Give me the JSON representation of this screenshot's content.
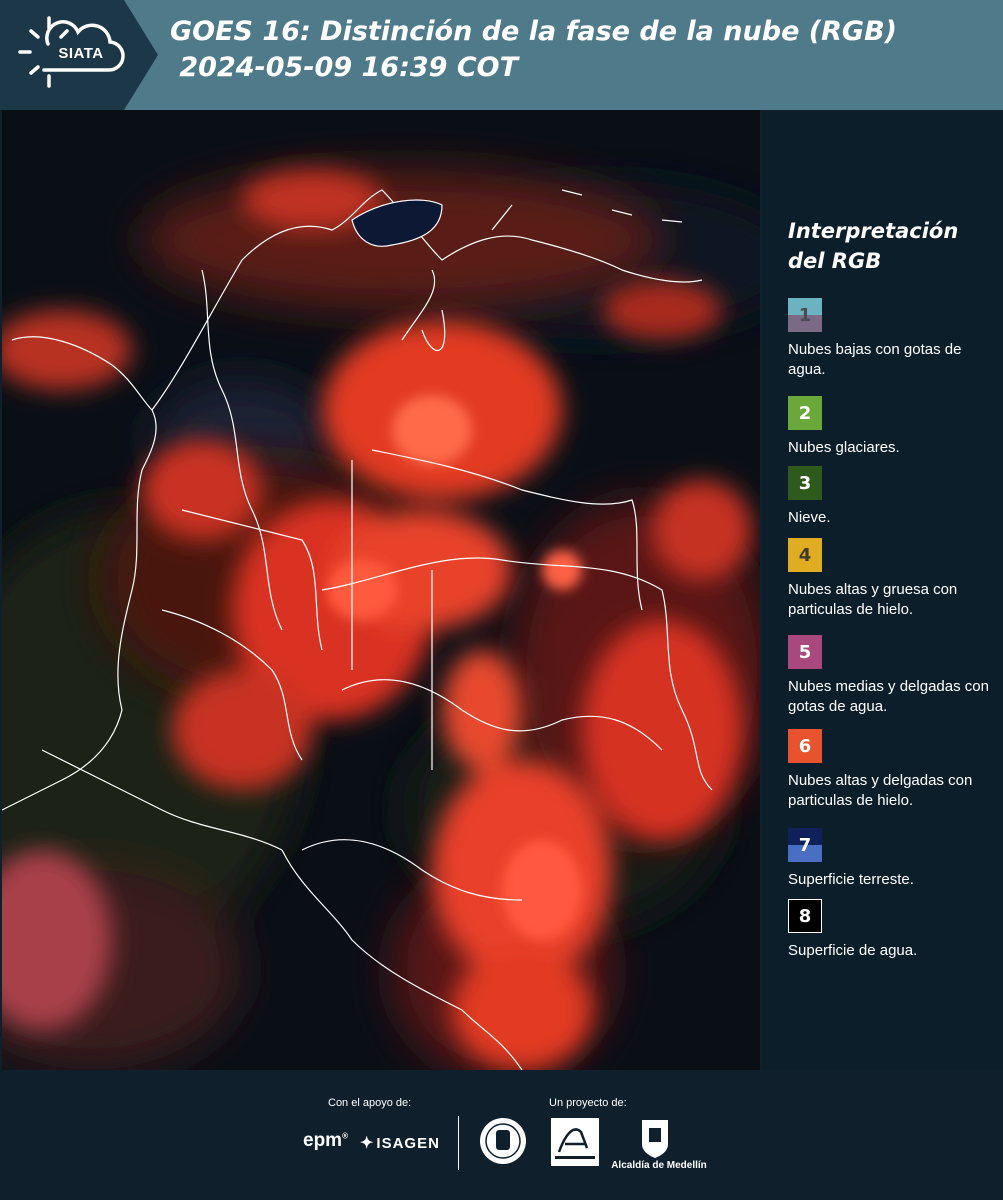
{
  "header": {
    "logo_text": "SIATA",
    "title": "GOES 16: Distinción de la fase de la nube (RGB)\n 2024-05-09 16:39 COT"
  },
  "legend": {
    "title": "Interpretación del RGB",
    "items": [
      {
        "number": "1",
        "description": "Nubes bajas con gotas de agua.",
        "color_top": "#6cb3c1",
        "color_bottom": "#7a6a86",
        "text_color": "#4a4a55"
      },
      {
        "number": "2",
        "description": "Nubes glaciares.",
        "color_top": "#6aa83a",
        "color_bottom": "#6aa83a",
        "text_color": "#ffffff"
      },
      {
        "number": "3",
        "description": "Nieve.",
        "color_top": "#2e5a1c",
        "color_bottom": "#2e5a1c",
        "text_color": "#ffffff"
      },
      {
        "number": "4",
        "description": "Nubes altas y gruesa con particulas de hielo.",
        "color_top": "#e0ad22",
        "color_bottom": "#e0ad22",
        "text_color": "#3f3a2c"
      },
      {
        "number": "5",
        "description": "Nubes medias y delgadas con gotas de agua.",
        "color_top": "#a8487e",
        "color_bottom": "#a8487e",
        "text_color": "#ffffff"
      },
      {
        "number": "6",
        "description": "Nubes altas y delgadas con particulas de hielo.",
        "color_top": "#e8522c",
        "color_bottom": "#e8522c",
        "text_color": "#ffffff"
      },
      {
        "number": "7",
        "description": "Superficie terreste.",
        "color_top": "#10205a",
        "color_bottom": "#4a6ec4",
        "text_color": "#ffffff"
      },
      {
        "number": "8",
        "description": "Superficie de agua.",
        "color_top": "#000000",
        "color_bottom": "#000000",
        "text_color": "#ffffff",
        "border": "#ffffff"
      }
    ]
  },
  "footer": {
    "support_label": "Con el apoyo de:",
    "project_label": "Un proyecto de:",
    "sponsors": [
      "epm",
      "ISAGEN"
    ],
    "alcaldia_text": "Alcaldía de Medellín"
  },
  "colors": {
    "header_bg": "#4f7a8a",
    "panel_bg": "#0d1e2b",
    "cloud_red": "#e23a22",
    "cloud_dark": "#4a1410",
    "ground": "#0a0f16"
  },
  "icons": [
    "sun-cloud-logo-icon",
    "university-seal-icon",
    "area-metropolitana-logo-icon",
    "alcaldia-shield-icon"
  ]
}
